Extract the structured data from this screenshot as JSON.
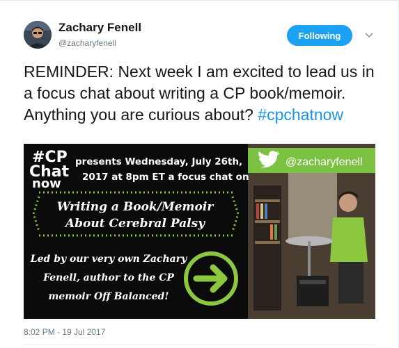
{
  "tweet": {
    "author": {
      "display_name": "Zachary Fenell",
      "handle": "@zacharyfenell"
    },
    "follow_label": "Following",
    "text_main": "REMINDER: Next week I am excited to lead us in a focus chat about writing a CP book/memoir. Anything you are curious about? ",
    "hashtag": "#cpchatnow",
    "timestamp": "8:02 PM - 19 Jul 2017"
  },
  "media": {
    "logo_line1": "#CP",
    "logo_line2": "Chat",
    "logo_line3": "now",
    "presents_line1": "presents Wednesday, July 26th,",
    "presents_line2": "2017 at 8pm ET a focus chat on",
    "topic_line1": "Writing a Book/Memoir",
    "topic_line2": "About Cerebral Palsy",
    "led_line1": "Led by our very own Zachary",
    "led_line2": "Fenell, author to the CP",
    "led_line3": "memoir Off Balanced!",
    "twitter_handle": "@zacharyfenell"
  },
  "colors": {
    "brand_blue": "#1da1f2",
    "hashtag_blue": "#1b95e0",
    "accent_green": "#8dc63f",
    "banner_green": "#7cc242"
  },
  "icons": {
    "chevron": "chevron-down-icon",
    "twitter_bird": "twitter-bird-icon",
    "arrow": "arrow-right-icon"
  }
}
